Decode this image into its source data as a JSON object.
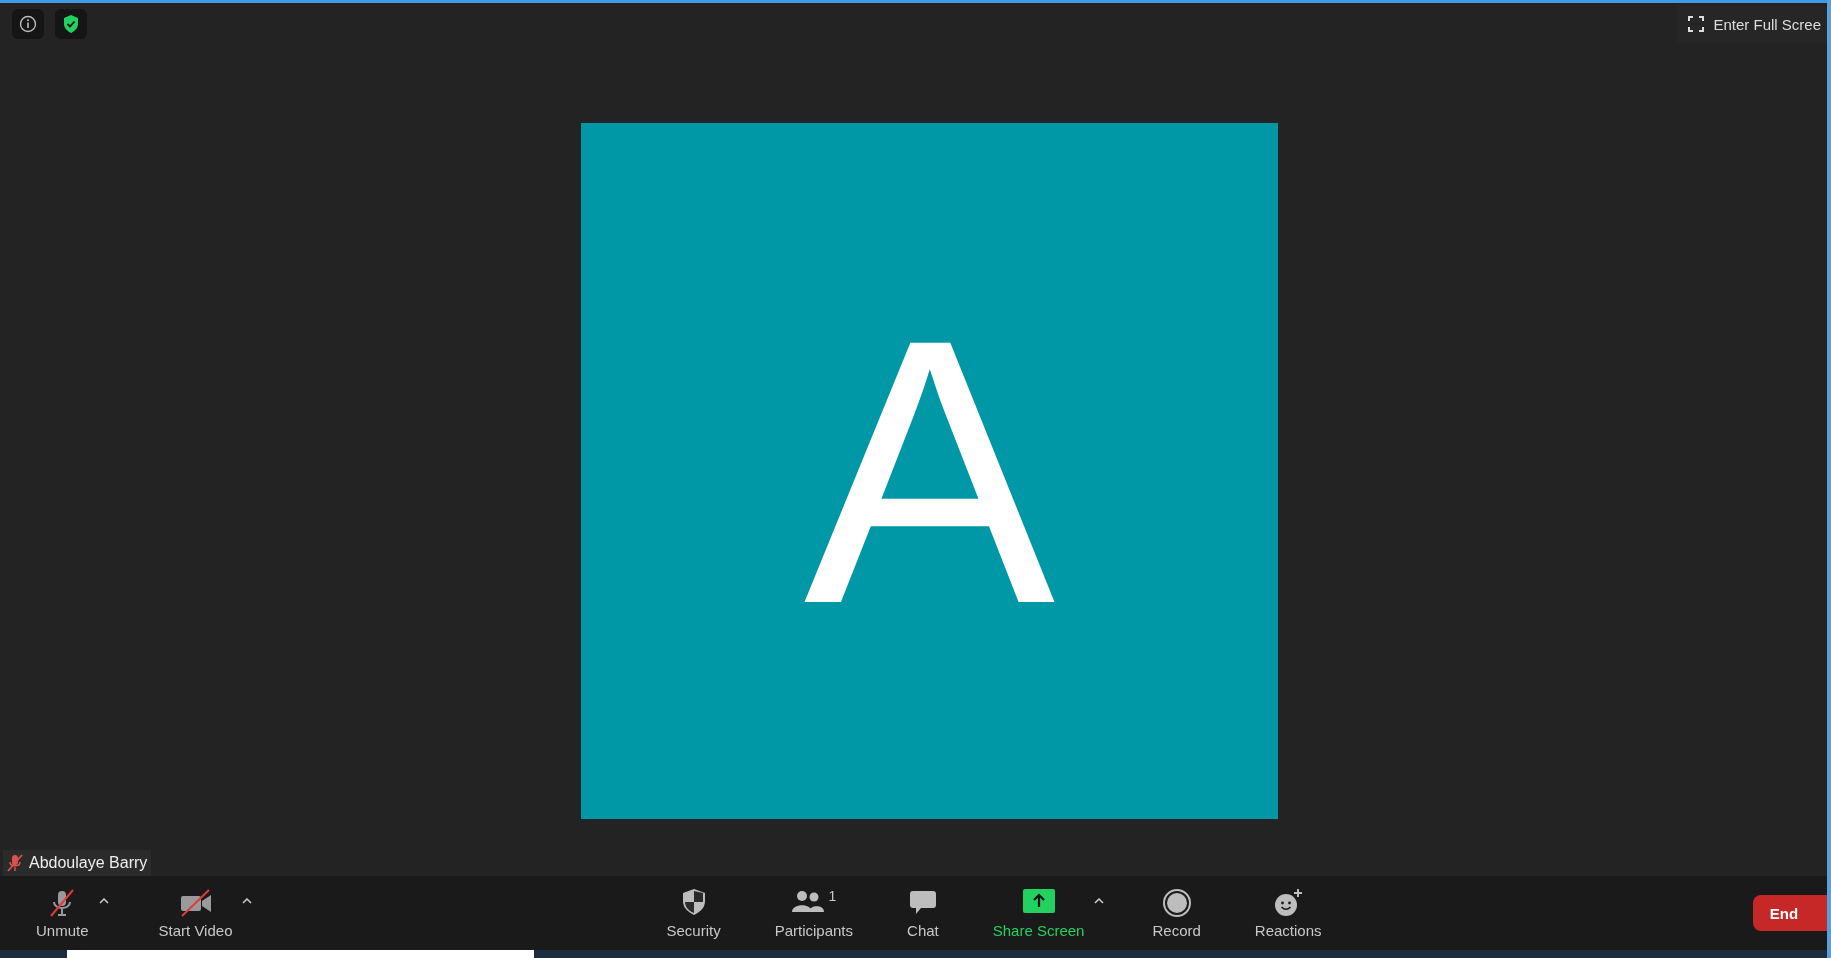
{
  "top_bar": {
    "full_screen_label": "Enter Full Scree"
  },
  "participant": {
    "initial": "A",
    "name": "Abdoulaye Barry",
    "muted": true
  },
  "toolbar": {
    "left": [
      {
        "kind": "audio",
        "label": "Unmute",
        "off": true,
        "has_menu": true
      },
      {
        "kind": "video",
        "label": "Start Video",
        "off": true,
        "has_menu": true
      }
    ],
    "center": [
      {
        "kind": "security",
        "label": "Security",
        "has_menu": false
      },
      {
        "kind": "participants",
        "label": "Participants",
        "count": "1",
        "has_menu": false
      },
      {
        "kind": "chat",
        "label": "Chat",
        "has_menu": false
      },
      {
        "kind": "share",
        "label": "Share Screen",
        "has_menu": true
      },
      {
        "kind": "record",
        "label": "Record",
        "has_menu": false
      },
      {
        "kind": "reactions",
        "label": "Reactions",
        "has_menu": false
      }
    ],
    "end_label": "End"
  }
}
